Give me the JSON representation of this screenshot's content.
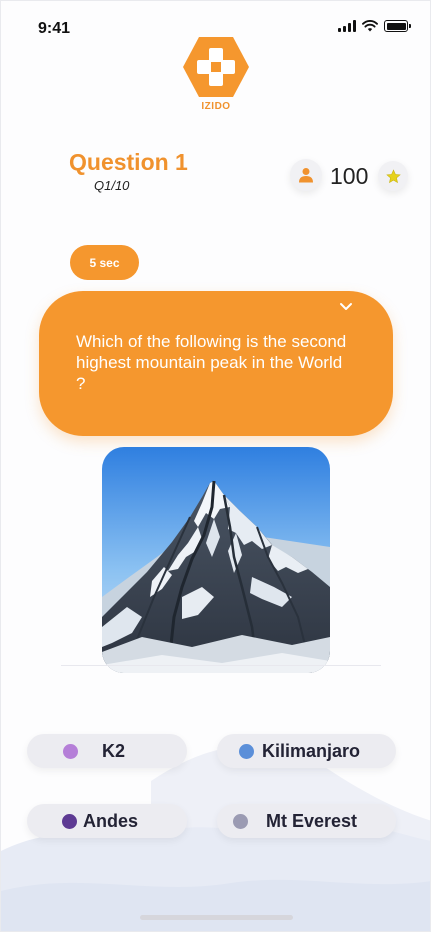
{
  "status_bar": {
    "time": "9:41"
  },
  "app": {
    "logo_text": "IZIDO",
    "brand_color": "#f0922e"
  },
  "header": {
    "title": "Question 1",
    "progress": "Q1/10",
    "score": "100",
    "user_icon": "user-icon",
    "star_icon": "star-icon"
  },
  "timer": {
    "label": "5 sec"
  },
  "question": {
    "text": "Which of the following is the second highest mountain peak in the World ?",
    "expand_icon": "chevron-down-icon"
  },
  "image": {
    "subject": "snow-covered mountain peak"
  },
  "answers": [
    {
      "label": "K2",
      "dot_color": "#b57fd8"
    },
    {
      "label": "Kilimanjaro",
      "dot_color": "#5b8fd9"
    },
    {
      "label": "Andes",
      "dot_color": "#5d3a93"
    },
    {
      "label": "Mt Everest",
      "dot_color": "#9b9bb3"
    }
  ]
}
